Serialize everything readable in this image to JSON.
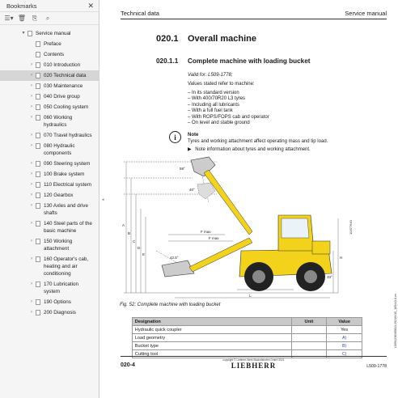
{
  "sidebar": {
    "title": "Bookmarks",
    "close_icon": "close-icon",
    "tools": [
      "list-options-icon",
      "delete-icon",
      "add-bookmark-icon",
      "find-bookmark-icon"
    ],
    "items": [
      {
        "label": "Service manual",
        "level": 0,
        "expanded": true,
        "arrow": "▾"
      },
      {
        "label": "Preface",
        "level": 1,
        "arrow": ""
      },
      {
        "label": "Contents",
        "level": 1,
        "arrow": ""
      },
      {
        "label": "010 Introduction",
        "level": 1,
        "arrow": "›"
      },
      {
        "label": "020 Technical data",
        "level": 1,
        "arrow": "›",
        "selected": true
      },
      {
        "label": "030 Maintenance",
        "level": 1,
        "arrow": "›"
      },
      {
        "label": "040 Drive group",
        "level": 1,
        "arrow": "›"
      },
      {
        "label": "050 Cooling system",
        "level": 1,
        "arrow": "›"
      },
      {
        "label": "060 Working hydraulics",
        "level": 1,
        "arrow": "›"
      },
      {
        "label": "070 Travel hydraulics",
        "level": 1,
        "arrow": "›"
      },
      {
        "label": "080 Hydraulic components",
        "level": 1,
        "arrow": "›"
      },
      {
        "label": "090 Steering system",
        "level": 1,
        "arrow": "›"
      },
      {
        "label": "100 Brake system",
        "level": 1,
        "arrow": "›"
      },
      {
        "label": "110 Electrical system",
        "level": 1,
        "arrow": "›"
      },
      {
        "label": "120 Gearbox",
        "level": 1,
        "arrow": "›"
      },
      {
        "label": "130 Axles and drive shafts",
        "level": 1,
        "arrow": "›"
      },
      {
        "label": "140 Steel parts of the basic machine",
        "level": 1,
        "arrow": "›"
      },
      {
        "label": "150 Working attachment",
        "level": 1,
        "arrow": "›"
      },
      {
        "label": "160 Operator's cab, heating and air conditioning",
        "level": 1,
        "arrow": "›"
      },
      {
        "label": "170 Lubrication system",
        "level": 1,
        "arrow": "›"
      },
      {
        "label": "190 Options",
        "level": 1,
        "arrow": "›"
      },
      {
        "label": "200 Diagnosis",
        "level": 1,
        "arrow": "›"
      }
    ]
  },
  "page": {
    "header_left": "Technical data",
    "header_right": "Service manual",
    "section_num": "020.1",
    "section_title": "Overall machine",
    "subsection_num": "020.1.1",
    "subsection_title": "Complete machine with loading bucket",
    "valid_for": "Valid for: L509-1778;",
    "intro": "Values stated refer to machine:",
    "bullets": [
      "In its standard version",
      "With 400/70R20 L3 tyres",
      "Including all lubricants",
      "With a full fuel tank",
      "With ROPS/FOPS cab and operator",
      "On level and stable ground"
    ],
    "note_icon": "info-icon",
    "note_label": "Note",
    "note_text": "Tyres and working attachment affect operating mass and tip load.",
    "note_arrow": "▶",
    "note_ref": "Note information about tyres and working attachment.",
    "figure_caption": "Fig. 52: Complete machine with loading bucket",
    "figure_id": "10377640",
    "figure_labels": {
      "angle_top": "58°",
      "angle_mid": "40°",
      "angle_low": "42.5°",
      "angle_rear": "33°",
      "dims": [
        "A",
        "B",
        "C",
        "D",
        "E",
        "F",
        "G",
        "H",
        "I",
        "J",
        "K",
        "L",
        "M",
        "N"
      ],
      "fmax": "F max",
      "fmax2": "F max"
    },
    "table": {
      "headers": [
        "Designation",
        "Unit",
        "Value"
      ],
      "rows": [
        {
          "designation": "Hydraulic quick coupler",
          "unit": "",
          "value": "Yes",
          "link": false
        },
        {
          "designation": "Load geometry",
          "unit": "",
          "value": "A)",
          "link": true
        },
        {
          "designation": "Bucket type",
          "unit": "",
          "value": "B)",
          "link": true
        },
        {
          "designation": "Cutting tool",
          "unit": "",
          "value": "C)",
          "link": true
        }
      ]
    },
    "footer": {
      "page_num": "020-4",
      "copyright": "copyright © Liebherr-Werk Bischofshofen GmbH 2021",
      "logo": "LIEBHERR",
      "doc_id": "L509-1778",
      "side_code": "L5091238185813-20210415_105443.8.en"
    }
  },
  "colors": {
    "machine_yellow": "#f2d21a",
    "selected_bookmark": "#d6d6d6",
    "table_header": "#c8c8c8",
    "link": "#2a3fbf"
  }
}
